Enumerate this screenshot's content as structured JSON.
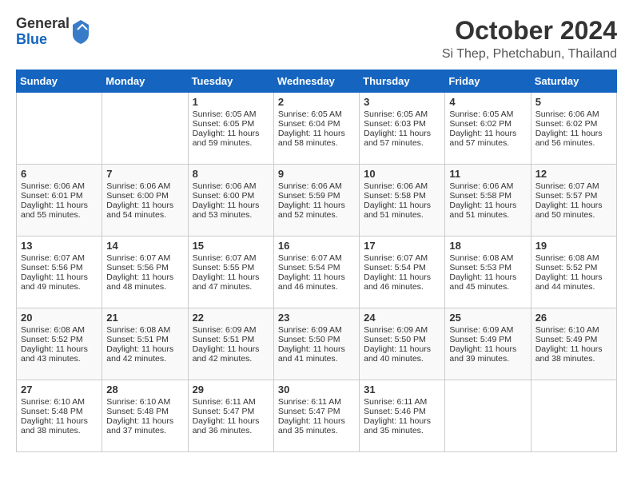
{
  "header": {
    "logo": {
      "general": "General",
      "blue": "Blue"
    },
    "title": "October 2024",
    "location": "Si Thep, Phetchabun, Thailand"
  },
  "days_of_week": [
    "Sunday",
    "Monday",
    "Tuesday",
    "Wednesday",
    "Thursday",
    "Friday",
    "Saturday"
  ],
  "weeks": [
    [
      {
        "day": "",
        "info": ""
      },
      {
        "day": "",
        "info": ""
      },
      {
        "day": "1",
        "info": "Sunrise: 6:05 AM\nSunset: 6:05 PM\nDaylight: 11 hours and 59 minutes."
      },
      {
        "day": "2",
        "info": "Sunrise: 6:05 AM\nSunset: 6:04 PM\nDaylight: 11 hours and 58 minutes."
      },
      {
        "day": "3",
        "info": "Sunrise: 6:05 AM\nSunset: 6:03 PM\nDaylight: 11 hours and 57 minutes."
      },
      {
        "day": "4",
        "info": "Sunrise: 6:05 AM\nSunset: 6:02 PM\nDaylight: 11 hours and 57 minutes."
      },
      {
        "day": "5",
        "info": "Sunrise: 6:06 AM\nSunset: 6:02 PM\nDaylight: 11 hours and 56 minutes."
      }
    ],
    [
      {
        "day": "6",
        "info": "Sunrise: 6:06 AM\nSunset: 6:01 PM\nDaylight: 11 hours and 55 minutes."
      },
      {
        "day": "7",
        "info": "Sunrise: 6:06 AM\nSunset: 6:00 PM\nDaylight: 11 hours and 54 minutes."
      },
      {
        "day": "8",
        "info": "Sunrise: 6:06 AM\nSunset: 6:00 PM\nDaylight: 11 hours and 53 minutes."
      },
      {
        "day": "9",
        "info": "Sunrise: 6:06 AM\nSunset: 5:59 PM\nDaylight: 11 hours and 52 minutes."
      },
      {
        "day": "10",
        "info": "Sunrise: 6:06 AM\nSunset: 5:58 PM\nDaylight: 11 hours and 51 minutes."
      },
      {
        "day": "11",
        "info": "Sunrise: 6:06 AM\nSunset: 5:58 PM\nDaylight: 11 hours and 51 minutes."
      },
      {
        "day": "12",
        "info": "Sunrise: 6:07 AM\nSunset: 5:57 PM\nDaylight: 11 hours and 50 minutes."
      }
    ],
    [
      {
        "day": "13",
        "info": "Sunrise: 6:07 AM\nSunset: 5:56 PM\nDaylight: 11 hours and 49 minutes."
      },
      {
        "day": "14",
        "info": "Sunrise: 6:07 AM\nSunset: 5:56 PM\nDaylight: 11 hours and 48 minutes."
      },
      {
        "day": "15",
        "info": "Sunrise: 6:07 AM\nSunset: 5:55 PM\nDaylight: 11 hours and 47 minutes."
      },
      {
        "day": "16",
        "info": "Sunrise: 6:07 AM\nSunset: 5:54 PM\nDaylight: 11 hours and 46 minutes."
      },
      {
        "day": "17",
        "info": "Sunrise: 6:07 AM\nSunset: 5:54 PM\nDaylight: 11 hours and 46 minutes."
      },
      {
        "day": "18",
        "info": "Sunrise: 6:08 AM\nSunset: 5:53 PM\nDaylight: 11 hours and 45 minutes."
      },
      {
        "day": "19",
        "info": "Sunrise: 6:08 AM\nSunset: 5:52 PM\nDaylight: 11 hours and 44 minutes."
      }
    ],
    [
      {
        "day": "20",
        "info": "Sunrise: 6:08 AM\nSunset: 5:52 PM\nDaylight: 11 hours and 43 minutes."
      },
      {
        "day": "21",
        "info": "Sunrise: 6:08 AM\nSunset: 5:51 PM\nDaylight: 11 hours and 42 minutes."
      },
      {
        "day": "22",
        "info": "Sunrise: 6:09 AM\nSunset: 5:51 PM\nDaylight: 11 hours and 42 minutes."
      },
      {
        "day": "23",
        "info": "Sunrise: 6:09 AM\nSunset: 5:50 PM\nDaylight: 11 hours and 41 minutes."
      },
      {
        "day": "24",
        "info": "Sunrise: 6:09 AM\nSunset: 5:50 PM\nDaylight: 11 hours and 40 minutes."
      },
      {
        "day": "25",
        "info": "Sunrise: 6:09 AM\nSunset: 5:49 PM\nDaylight: 11 hours and 39 minutes."
      },
      {
        "day": "26",
        "info": "Sunrise: 6:10 AM\nSunset: 5:49 PM\nDaylight: 11 hours and 38 minutes."
      }
    ],
    [
      {
        "day": "27",
        "info": "Sunrise: 6:10 AM\nSunset: 5:48 PM\nDaylight: 11 hours and 38 minutes."
      },
      {
        "day": "28",
        "info": "Sunrise: 6:10 AM\nSunset: 5:48 PM\nDaylight: 11 hours and 37 minutes."
      },
      {
        "day": "29",
        "info": "Sunrise: 6:11 AM\nSunset: 5:47 PM\nDaylight: 11 hours and 36 minutes."
      },
      {
        "day": "30",
        "info": "Sunrise: 6:11 AM\nSunset: 5:47 PM\nDaylight: 11 hours and 35 minutes."
      },
      {
        "day": "31",
        "info": "Sunrise: 6:11 AM\nSunset: 5:46 PM\nDaylight: 11 hours and 35 minutes."
      },
      {
        "day": "",
        "info": ""
      },
      {
        "day": "",
        "info": ""
      }
    ]
  ]
}
